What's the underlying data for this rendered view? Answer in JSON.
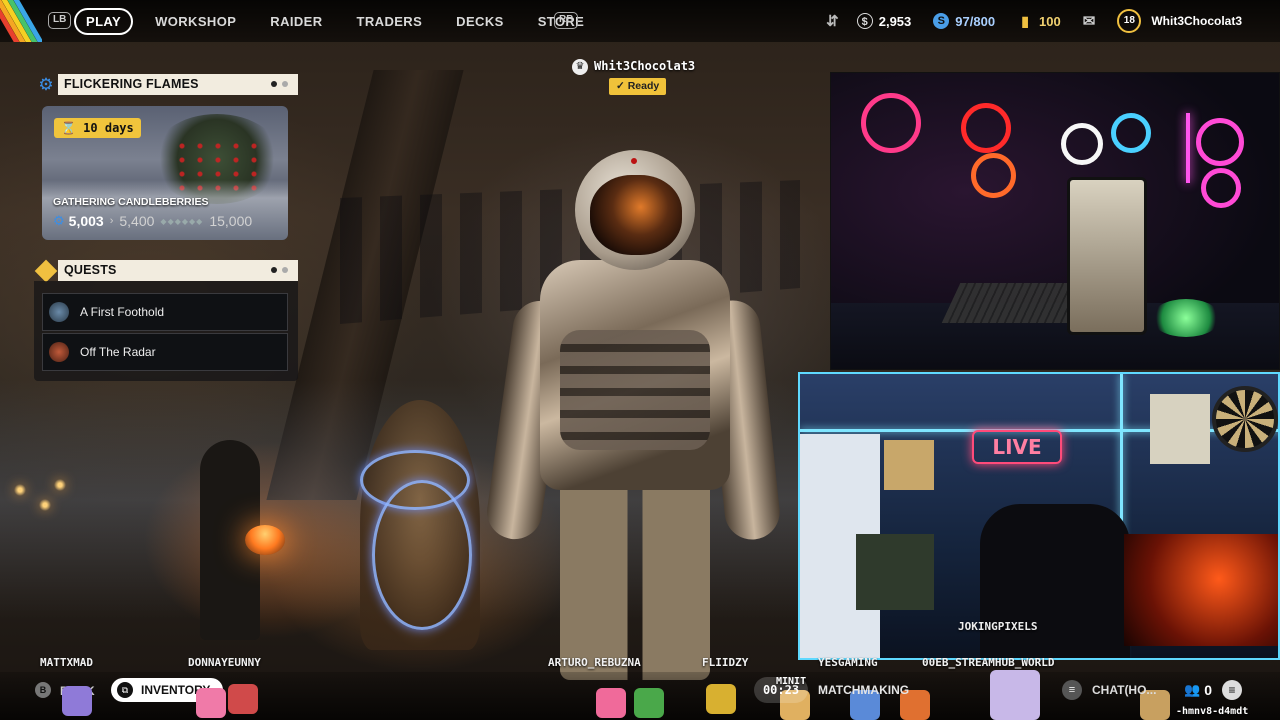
{
  "topbar": {
    "lb": "LB",
    "rb": "RB",
    "nav": [
      "PLAY",
      "WORKSHOP",
      "RAIDER",
      "TRADERS",
      "DECKS",
      "STORE"
    ],
    "coins": "2,953",
    "slots": "97/800",
    "tokens": "100",
    "level": "18",
    "username": "Whit3Chocolat3"
  },
  "event": {
    "title": "FLICKERING FLAMES",
    "days": "10 days",
    "name": "GATHERING CANDLEBERRIES",
    "current": "5,003",
    "next": "5,400",
    "max": "15,000"
  },
  "quests": {
    "title": "QUESTS",
    "items": [
      "A First Foothold",
      "Off The Radar"
    ]
  },
  "lobby": {
    "player": "Whit3Chocolat3",
    "status": "Ready"
  },
  "webcam": {
    "live_sign": "LIVE",
    "streamer": "JOKINGPIXELS"
  },
  "squad": [
    "MATTXMAD",
    "DONNAYEUNNY",
    "ARTURO_REBUZNA",
    "FLIIDZY",
    "YESGAMING",
    "00EB_STREAMHUB_WORLD"
  ],
  "bottom": {
    "back_key": "B",
    "back": "BACK",
    "inventory": "INVENTORY",
    "timer": "00:23",
    "overlay_tag": "MINIT",
    "matchmaking": "MATCHMAKING",
    "chat": "CHAT(HO...",
    "party_count": "0",
    "handle": "-hmnv8-d4mdt"
  },
  "colors": {
    "accent_yellow": "#f0c23a",
    "panel_cream": "#f2ecdf",
    "gear_blue": "#3a8ee6",
    "quest_yellow": "#f0c040"
  }
}
